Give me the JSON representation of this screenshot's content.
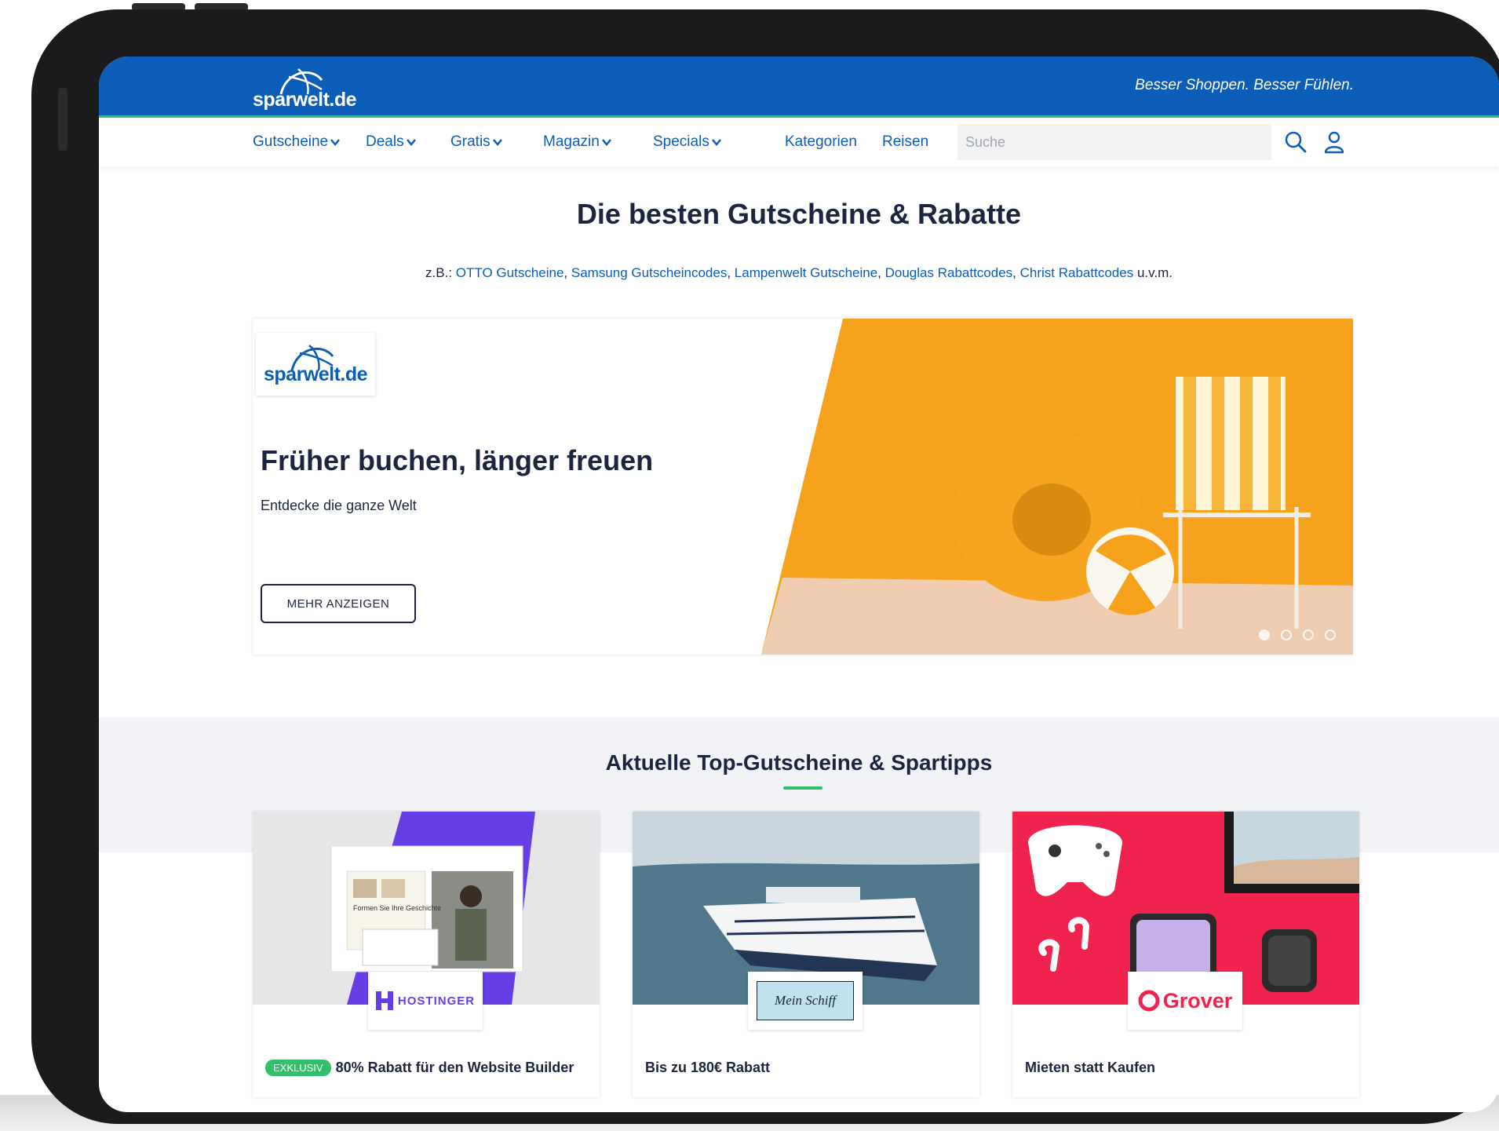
{
  "header": {
    "logo_text": "sparwelt.de",
    "slogan": "Besser Shoppen. Besser Fühlen."
  },
  "nav": {
    "items": [
      {
        "label": "Gutscheine",
        "has_dropdown": true
      },
      {
        "label": "Deals",
        "has_dropdown": true
      },
      {
        "label": "Gratis",
        "has_dropdown": true
      },
      {
        "label": "Magazin",
        "has_dropdown": true
      },
      {
        "label": "Specials",
        "has_dropdown": true
      },
      {
        "label": "Kategorien",
        "has_dropdown": false
      },
      {
        "label": "Reisen",
        "has_dropdown": false
      }
    ],
    "search_placeholder": "Suche"
  },
  "hero": {
    "title": "Die besten Gutscheine & Rabatte",
    "examples_prefix": "z.B.:",
    "examples": [
      "OTTO Gutscheine",
      "Samsung Gutscheincodes",
      "Lampenwelt Gutscheine",
      "Douglas Rabattcodes",
      "Christ Rabattcodes"
    ],
    "examples_suffix": "u.v.m."
  },
  "banner": {
    "logo_text": "sparwelt.de",
    "headline": "Früher buchen, länger freuen",
    "subline": "Entdecke die ganze Welt",
    "button_label": "MEHR ANZEIGEN",
    "slides_total": 4,
    "active_slide": 1
  },
  "top_deals": {
    "title": "Aktuelle Top-Gutscheine & Spartipps",
    "cards": [
      {
        "brand": "HOSTINGER",
        "badge": "EXKLUSIV",
        "title": "80% Rabatt für den Website Builder",
        "mock_text": "Formen Sie Ihre Geschichte"
      },
      {
        "brand": "Mein Schiff",
        "badge": "",
        "title": "Bis zu 180€ Rabatt"
      },
      {
        "brand": "Grover",
        "badge": "",
        "title": "Mieten statt Kaufen"
      }
    ]
  },
  "colors": {
    "brand_blue": "#0b5db8",
    "accent_green": "#32c06a",
    "text_dark": "#1c2540",
    "banner_orange": "#f6a21c",
    "grover_red": "#f0234f",
    "hostinger_purple": "#673de6"
  }
}
